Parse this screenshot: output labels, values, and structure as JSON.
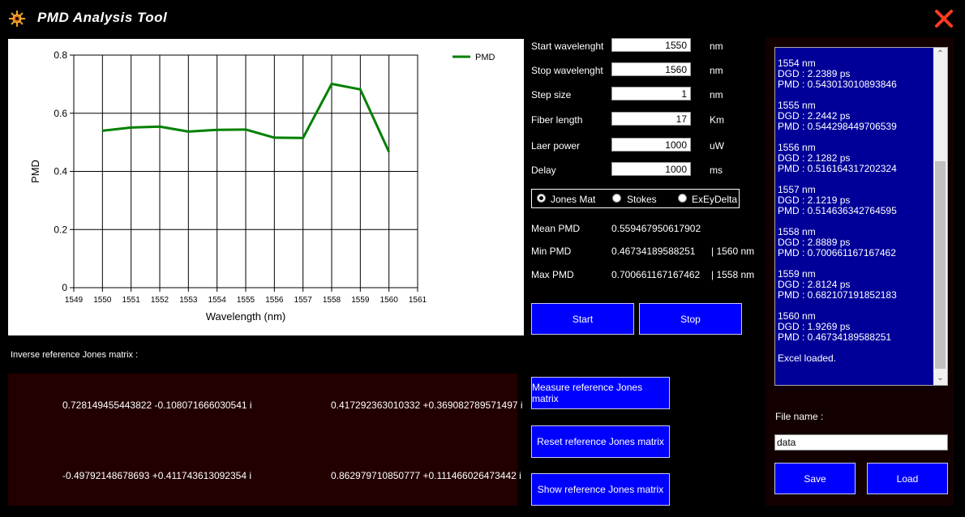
{
  "window": {
    "title": "PMD Analysis Tool"
  },
  "chart_data": {
    "type": "line",
    "x": [
      1550,
      1551,
      1552,
      1553,
      1554,
      1555,
      1556,
      1557,
      1558,
      1559,
      1560
    ],
    "series": [
      {
        "name": "PMD",
        "color": "#008000",
        "values": [
          0.54,
          0.551,
          0.554,
          0.537,
          0.543,
          0.544,
          0.516,
          0.515,
          0.701,
          0.682,
          0.467
        ]
      }
    ],
    "xlabel": "Wavelength (nm)",
    "ylabel": "PMD",
    "xlim": [
      1549,
      1561
    ],
    "ylim": [
      0,
      0.8
    ],
    "xticks": [
      "1549",
      "1550",
      "1551",
      "1552",
      "1553",
      "1554",
      "1555",
      "1556",
      "1557",
      "1558",
      "1559",
      "1560",
      "1561"
    ],
    "yticks": [
      "0",
      "0.2",
      "0.4",
      "0.6",
      "0.8"
    ],
    "grid": true,
    "legend": "top-right"
  },
  "params": {
    "start": {
      "label": "Start wavelenght",
      "value": "1550",
      "unit": "nm"
    },
    "stop": {
      "label": "Stop wavelenght",
      "value": "1560",
      "unit": "nm"
    },
    "step": {
      "label": "Step size",
      "value": "1",
      "unit": "nm"
    },
    "fiber": {
      "label": "Fiber length",
      "value": "17",
      "unit": "Km"
    },
    "laser": {
      "label": "Laer power",
      "value": "1000",
      "unit": "uW"
    },
    "delay": {
      "label": "Delay",
      "value": "1000",
      "unit": "ms"
    }
  },
  "modes": {
    "jones": "Jones Mat",
    "stokes": "Stokes",
    "exey": "ExEyDelta",
    "selected": "Jones Mat"
  },
  "stats": {
    "mean_label": "Mean PMD",
    "mean_value": "0.559467950617902",
    "min_label": "Min PMD",
    "min_value": "0.46734189588251",
    "min_at": "| 1560 nm",
    "max_label": "Max PMD",
    "max_value": "0.700661167167462",
    "max_at": "| 1558 nm"
  },
  "buttons": {
    "start": "Start",
    "stop": "Stop",
    "measure": "Measure reference Jones matrix",
    "reset": "Reset reference Jones matrix",
    "show": "Show reference Jones matrix",
    "save": "Save",
    "load": "Load"
  },
  "matrix": {
    "label": "Inverse reference Jones matrix :",
    "m11": "0.728149455443822 -0.108071666030541 i",
    "m12": "0.417292363010332 +0.369082789571497 i",
    "m21": "-0.49792148678693 +0.411743613092354 i",
    "m22": "0.862979710850777 +0.111466026473442 i"
  },
  "log": "1554 nm\nDGD : 2.2389 ps\nPMD : 0.543013010893846\n\n1555 nm\nDGD : 2.2442 ps\nPMD : 0.544298449706539\n\n1556 nm\nDGD : 2.1282 ps\nPMD : 0.516164317202324\n\n1557 nm\nDGD : 2.1219 ps\nPMD : 0.514636342764595\n\n1558 nm\nDGD : 2.8889 ps\nPMD : 0.700661167167462\n\n1559 nm\nDGD : 2.8124 ps\nPMD : 0.682107191852183\n\n1560 nm\nDGD : 1.9269 ps\nPMD : 0.46734189588251\n\nExcel loaded.",
  "file": {
    "label": "File name :",
    "value": "data"
  },
  "icons": {
    "logo": "sun-icon",
    "close": "close-icon"
  }
}
